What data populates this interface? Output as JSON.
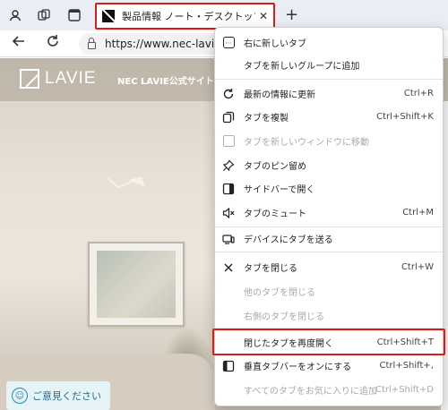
{
  "browser": {
    "tab": {
      "title": "製品情報 ノート・デスクトップパソコン",
      "close": "✕"
    },
    "newtab_glyph": "+",
    "address": {
      "url": "https://www.nec-lavie."
    }
  },
  "site": {
    "logo_text": "LAVIE",
    "header_text": "NEC LAVIE公式サイト",
    "feedback_label": "ご意見ください"
  },
  "menu": {
    "items": [
      {
        "label": "右に新しいタブ",
        "shortcut": "",
        "icon": "new-tab-right-icon",
        "disabled": false
      },
      {
        "label": "タブを新しいグループに追加",
        "shortcut": "",
        "icon": "",
        "disabled": false
      },
      {
        "label": "最新の情報に更新",
        "shortcut": "Ctrl+R",
        "icon": "refresh-icon",
        "disabled": false
      },
      {
        "label": "タブを複製",
        "shortcut": "Ctrl+Shift+K",
        "icon": "duplicate-icon",
        "disabled": false
      },
      {
        "label": "タブを新しいウィンドウに移動",
        "shortcut": "",
        "icon": "move-window-icon",
        "disabled": true
      },
      {
        "label": "タブのピン留め",
        "shortcut": "",
        "icon": "pin-icon",
        "disabled": false
      },
      {
        "label": "サイドバーで開く",
        "shortcut": "",
        "icon": "sidebar-icon",
        "disabled": false
      },
      {
        "label": "タブのミュート",
        "shortcut": "Ctrl+M",
        "icon": "mute-icon",
        "disabled": false
      },
      {
        "label": "デバイスにタブを送る",
        "shortcut": "",
        "icon": "send-device-icon",
        "disabled": false
      },
      {
        "label": "タブを閉じる",
        "shortcut": "Ctrl+W",
        "icon": "close-icon",
        "disabled": false
      },
      {
        "label": "他のタブを閉じる",
        "shortcut": "",
        "icon": "",
        "disabled": true
      },
      {
        "label": "右側のタブを閉じる",
        "shortcut": "",
        "icon": "",
        "disabled": true
      },
      {
        "label": "閉じたタブを再度開く",
        "shortcut": "Ctrl+Shift+T",
        "icon": "",
        "disabled": false
      },
      {
        "label": "垂直タブバーをオンにする",
        "shortcut": "Ctrl+Shift+,",
        "icon": "vertical-tabs-icon",
        "disabled": false
      },
      {
        "label": "すべてのタブをお気に入りに追加",
        "shortcut": "Ctrl+Shift+D",
        "icon": "",
        "disabled": true
      }
    ]
  },
  "colors": {
    "highlight": "#e01919",
    "accent": "#1b8fb5"
  }
}
